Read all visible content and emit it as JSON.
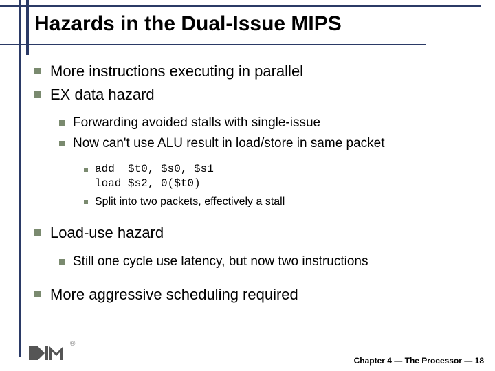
{
  "title": "Hazards in the Dual-Issue MIPS",
  "bullets": {
    "b1": "More instructions executing in parallel",
    "b2": "EX data hazard",
    "b2a": "Forwarding avoided stalls with single-issue",
    "b2b": "Now can't use ALU result in load/store in same packet",
    "b2b1_line1": "add  $t0, $s0, $s1",
    "b2b1_line2": "load $s2, 0($t0)",
    "b2b2": "Split into two packets, effectively a stall",
    "b3": "Load-use hazard",
    "b3a": "Still one cycle use latency, but now two instructions",
    "b4": "More aggressive scheduling required"
  },
  "footer": {
    "chapter": "Chapter 4 — The Processor — 18"
  }
}
